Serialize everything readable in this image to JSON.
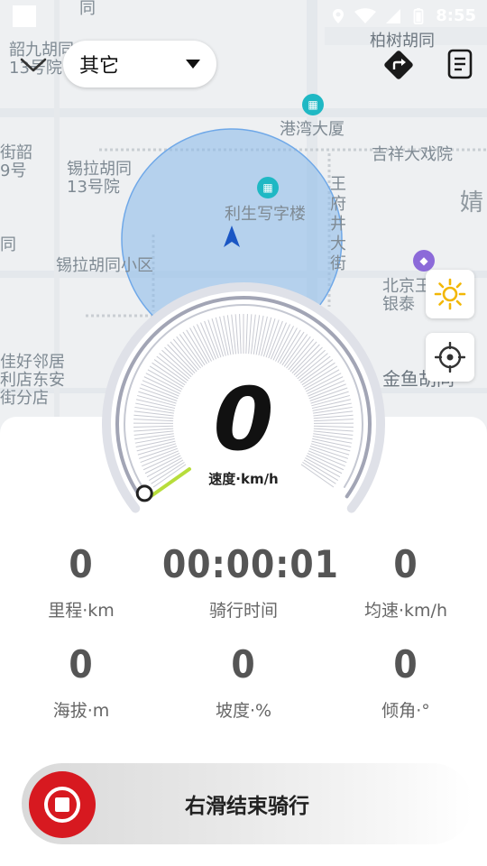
{
  "status_bar": {
    "time": "8:55",
    "icons": [
      "location-icon",
      "wifi-icon",
      "signal-icon",
      "battery-icon"
    ]
  },
  "top_bar": {
    "activity_select": {
      "selected": "其它"
    },
    "icons": [
      "chevron-down-icon",
      "route-icon",
      "record-list-icon"
    ]
  },
  "map": {
    "labels": {
      "top_left_fragment": "同",
      "shaojiu_hutong": "韶九胡同\n13号院",
      "baishu_hutong": "柏树胡同",
      "gangwan_building": "港湾大厦",
      "jixiang_theater": "吉祥大戏院",
      "jie_shao": "街韶\n9号",
      "xila_hutong_13": "锡拉胡同\n13号院",
      "lisheng_building": "利生写字楼",
      "wangfujing_street": "王府井大街",
      "jing_fragment": "婧",
      "tong_fragment": "同",
      "xila_hutong_xiaoqu": "锡拉胡同小区",
      "beijing_wang": "北京王\n银泰",
      "jiahao_linju": "佳好邻居\n利店东安\n街分店",
      "jinyu_hutong": "金鱼胡同"
    },
    "accent_location_color": "#1a56c4",
    "accuracy_circle_color": "#6fa8e8"
  },
  "speedometer": {
    "value": "0",
    "label": "速度·km/h",
    "fraction": 0
  },
  "stats": {
    "distance": {
      "value": "0",
      "label": "里程·km"
    },
    "ride_time": {
      "value": "00:00:01",
      "label": "骑行时间"
    },
    "avg_speed": {
      "value": "0",
      "label": "均速·km/h"
    },
    "altitude": {
      "value": "0",
      "label": "海拔·m"
    },
    "slope": {
      "value": "0",
      "label": "坡度·%"
    },
    "tilt": {
      "value": "0",
      "label": "倾角·°"
    }
  },
  "end_slider": {
    "label": "右滑结束骑行",
    "handle_icon": "stop-icon",
    "handle_color": "#d71920"
  },
  "floating_buttons": {
    "icons": [
      "sun-icon",
      "locate-crosshair-icon"
    ]
  }
}
